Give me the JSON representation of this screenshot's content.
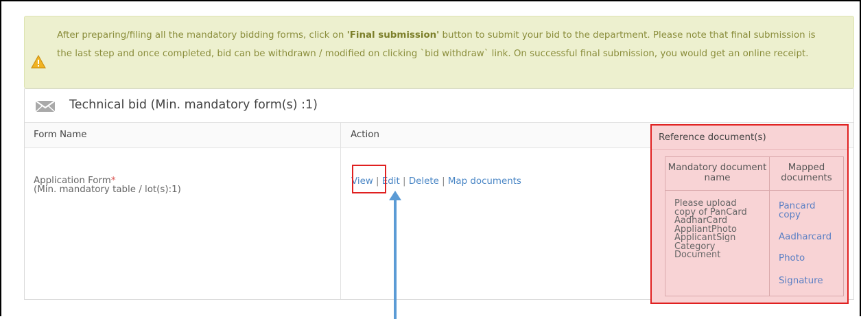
{
  "alert": {
    "text_before": "After preparing/filing all the mandatory bidding forms, click on ",
    "bold_text": "'Final submission'",
    "text_after": " button to submit your bid to the department. Please note that final submission is the last step and once completed, bid can be withdrawn / modified on clicking `bid withdraw` link. On successful final submission, you would get an online receipt.",
    "icon": "warning-icon"
  },
  "panel": {
    "icon": "envelope-icon",
    "title": "Technical bid (Min. mandatory form(s) :1)"
  },
  "table": {
    "headers": [
      "Form Name",
      "Action",
      "Reference document(s)"
    ],
    "row": {
      "form_name": "Application Form",
      "required_mark": "*",
      "form_note": "(Min. mandatory table / lot(s):1)",
      "actions": [
        "View",
        "Edit",
        "Delete",
        "Map documents"
      ],
      "separator": "|"
    }
  },
  "reference": {
    "headers": [
      "Mandatory document name",
      "Mapped documents"
    ],
    "mandatory_docs": [
      "Please upload",
      "copy of PanCard",
      "AadharCard",
      "AppliantPhoto",
      "ApplicantSign",
      "Category",
      "Document"
    ],
    "mapped_docs": [
      "Pancard copy",
      "Aadharcard",
      "Photo",
      "Signature"
    ]
  },
  "colors": {
    "alert_bg": "#edf0cf",
    "alert_text": "#8a8d3b",
    "link": "#4a86c5",
    "highlight_border": "#e02020",
    "highlight_fill": "#f8d3d5",
    "arrow": "#5b9bd5"
  }
}
